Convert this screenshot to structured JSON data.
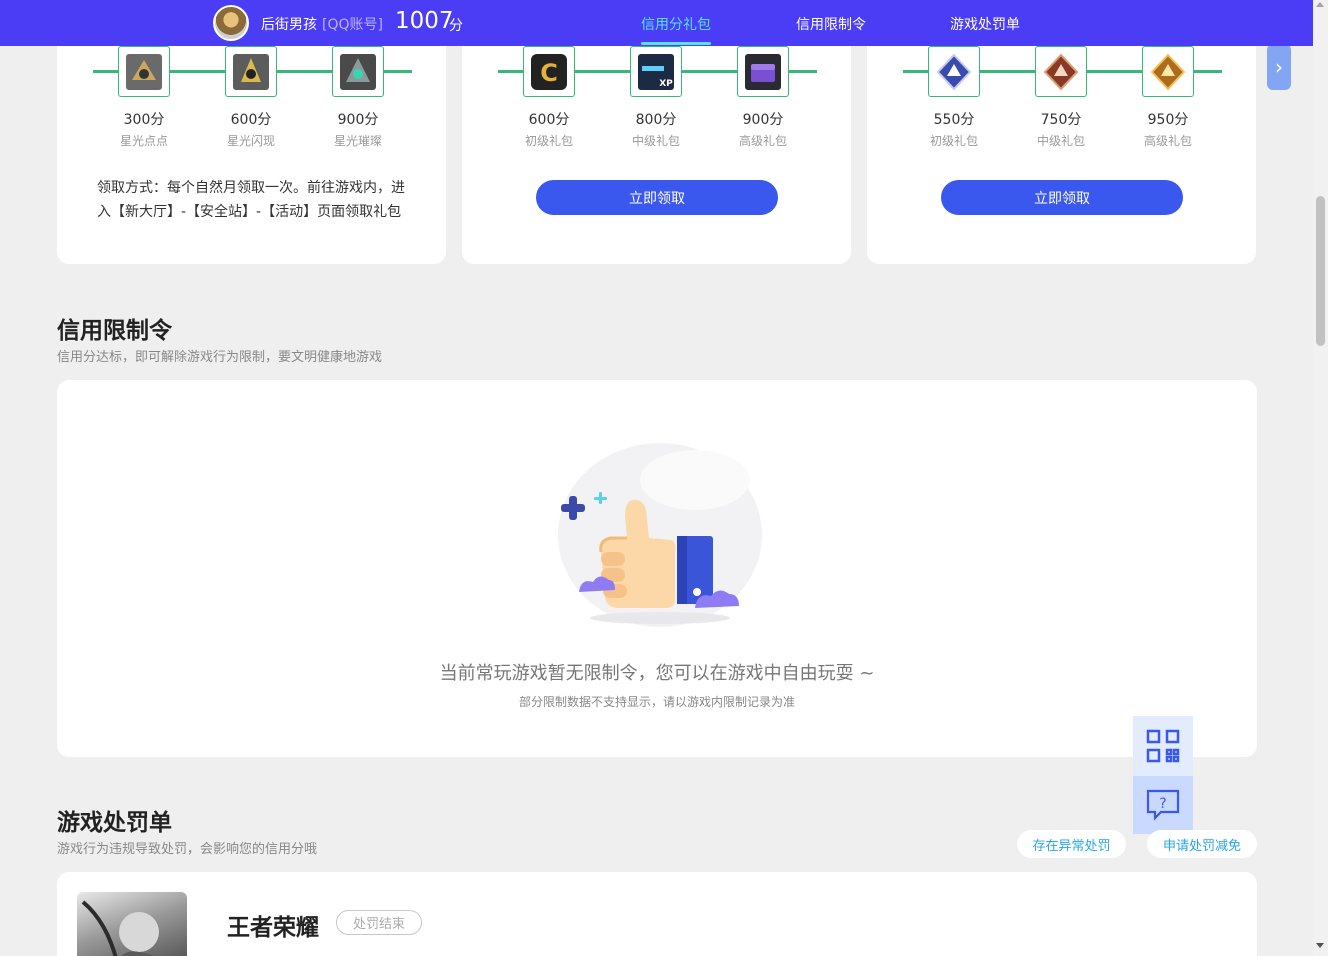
{
  "header": {
    "username": "后街男孩",
    "account_type": "[QQ账号]",
    "score": "1007",
    "score_unit": "分",
    "nav": [
      {
        "label": "信用分礼包",
        "active": true
      },
      {
        "label": "信用限制令",
        "active": false
      },
      {
        "label": "游戏处罚单",
        "active": false
      }
    ]
  },
  "gift_cards": [
    {
      "items": [
        {
          "points": "300分",
          "name": "星光点点",
          "icon": "sparkle-badge-icon"
        },
        {
          "points": "600分",
          "name": "星光闪现",
          "icon": "sparkle-badge-icon"
        },
        {
          "points": "900分",
          "name": "星光璀璨",
          "icon": "sparkle-badge-icon"
        }
      ],
      "note": "领取方式：每个自然月领取一次。前往游戏内，进入【新大厅】-【安全站】-【活动】页面领取礼包"
    },
    {
      "items": [
        {
          "points": "600分",
          "name": "初级礼包",
          "icon": "gold-c-emblem-icon"
        },
        {
          "points": "800分",
          "name": "中级礼包",
          "icon": "xp-card-icon"
        },
        {
          "points": "900分",
          "name": "高级礼包",
          "icon": "purple-chest-icon"
        }
      ],
      "button": "立即领取"
    },
    {
      "items": [
        {
          "points": "550分",
          "name": "初级礼包",
          "icon": "blue-rank-emblem-icon"
        },
        {
          "points": "750分",
          "name": "中级礼包",
          "icon": "bronze-rank-emblem-icon"
        },
        {
          "points": "950分",
          "name": "高级礼包",
          "icon": "gold-rank-emblem-icon"
        }
      ],
      "button": "立即领取"
    }
  ],
  "restriction": {
    "title": "信用限制令",
    "subtitle": "信用分达标，即可解除游戏行为限制，要文明健康地游戏",
    "empty_title": "当前常玩游戏暂无限制令，您可以在游戏中自由玩耍 ~",
    "empty_sub": "部分限制数据不支持显示，请以游戏内限制记录为准"
  },
  "penalty": {
    "title": "游戏处罚单",
    "subtitle": "游戏行为违规导致处罚，会影响您的信用分哦",
    "btn_abnormal": "存在异常处罚",
    "btn_reduce": "申请处罚减免",
    "game_name": "王者荣耀",
    "status": "处罚结束"
  },
  "colors": {
    "brand": "#4a3df5",
    "accent": "#3b58ee",
    "track": "#39b67a",
    "active_nav": "#56e3ff"
  }
}
